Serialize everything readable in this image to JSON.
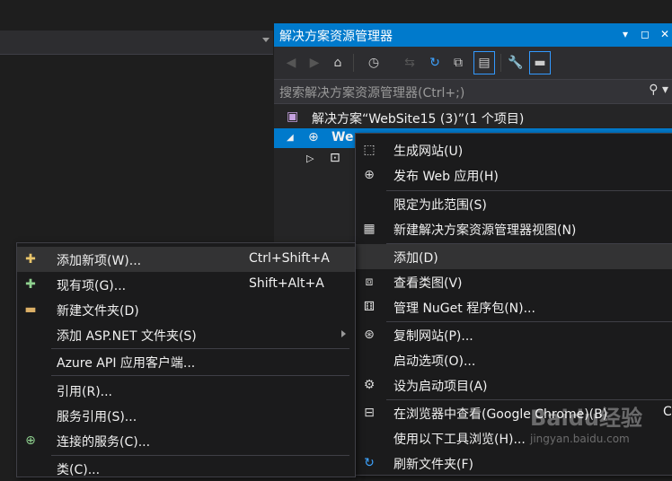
{
  "solution_explorer": {
    "title": "解决方案资源管理器",
    "title_buttons": [
      "▾",
      "◻",
      "✕"
    ],
    "search_placeholder": "搜索解决方案资源管理器(Ctrl+;)",
    "solution_label": "解决方案“WebSite15 (3)”(1 个项目)",
    "project_label": "We"
  },
  "project_menu": {
    "items": [
      {
        "label": "生成网站(U)",
        "icon": "build-icon"
      },
      {
        "label": "发布 Web 应用(H)",
        "icon": "globe-publish-icon"
      },
      {
        "label": "限定为此范围(S)",
        "icon": ""
      },
      {
        "label": "新建解决方案资源管理器视图(N)",
        "icon": "new-view-icon"
      },
      {
        "label": "添加(D)",
        "icon": ""
      },
      {
        "label": "查看类图(V)",
        "icon": "class-diagram-icon"
      },
      {
        "label": "管理 NuGet 程序包(N)...",
        "icon": "nuget-icon"
      },
      {
        "label": "复制网站(P)...",
        "icon": "copy-website-icon"
      },
      {
        "label": "启动选项(O)...",
        "icon": ""
      },
      {
        "label": "设为启动项目(A)",
        "icon": "gear-icon"
      },
      {
        "label": "在浏览器中查看(Google Chrome)(B)",
        "icon": "browser-icon",
        "shortcut": "C"
      },
      {
        "label": "使用以下工具浏览(H)...",
        "icon": ""
      },
      {
        "label": "刷新文件夹(F)",
        "icon": "refresh-icon"
      }
    ]
  },
  "add_menu": {
    "items": [
      {
        "label": "添加新项(W)...",
        "shortcut": "Ctrl+Shift+A",
        "icon": "add-new-item-icon"
      },
      {
        "label": "现有项(G)...",
        "shortcut": "Shift+Alt+A",
        "icon": "existing-item-icon"
      },
      {
        "label": "新建文件夹(D)",
        "shortcut": "",
        "icon": "new-folder-icon"
      },
      {
        "label": "添加 ASP.NET 文件夹(S)",
        "shortcut": "",
        "icon": ""
      },
      {
        "label": "Azure API 应用客户端...",
        "shortcut": "",
        "icon": ""
      },
      {
        "label": "引用(R)...",
        "shortcut": "",
        "icon": ""
      },
      {
        "label": "服务引用(S)...",
        "shortcut": "",
        "icon": ""
      },
      {
        "label": "连接的服务(C)...",
        "shortcut": "",
        "icon": "connected-service-icon"
      },
      {
        "label": "类(C)...",
        "shortcut": "",
        "icon": ""
      }
    ]
  },
  "watermark": {
    "brand": "Baidu经验",
    "url": "jingyan.baidu.com"
  }
}
